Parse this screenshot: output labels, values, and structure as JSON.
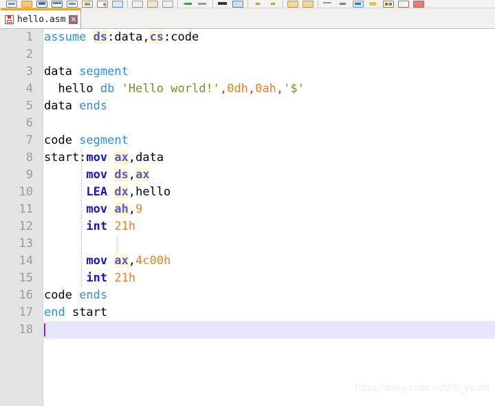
{
  "toolbar": {
    "items": [
      {
        "name": "new-file-icon",
        "glyph": "ic-doc"
      },
      {
        "name": "open-folder-icon",
        "glyph": "ic-folder"
      },
      {
        "name": "save-icon",
        "glyph": "ic-save"
      },
      {
        "name": "save-all-icon",
        "glyph": "ic-saveall"
      },
      {
        "name": "close-file-icon",
        "glyph": "ic-doc"
      },
      {
        "name": "print-icon",
        "glyph": "ic-print"
      },
      {
        "name": "print-preview-icon",
        "glyph": "ic-prev"
      },
      {
        "name": "cut-icon",
        "glyph": "ic-cut"
      },
      {
        "name": "separator",
        "glyph": "sep"
      },
      {
        "name": "copy-icon",
        "glyph": "ic-copy"
      },
      {
        "name": "paste-icon",
        "glyph": "ic-paste"
      },
      {
        "name": "duplicate-icon",
        "glyph": "ic-copy"
      },
      {
        "name": "separator",
        "glyph": "sep"
      },
      {
        "name": "undo-icon",
        "glyph": "ic-undo"
      },
      {
        "name": "redo-icon",
        "glyph": "ic-redo"
      },
      {
        "name": "separator",
        "glyph": "sep"
      },
      {
        "name": "find-icon",
        "glyph": "ic-find"
      },
      {
        "name": "replace-icon",
        "glyph": "ic-replace"
      },
      {
        "name": "separator",
        "glyph": "sep"
      },
      {
        "name": "zoom-in-icon",
        "glyph": "ic-zoomin"
      },
      {
        "name": "zoom-out-icon",
        "glyph": "ic-zoomout"
      },
      {
        "name": "separator",
        "glyph": "sep"
      },
      {
        "name": "tab-marker-icon",
        "glyph": "ic-tab1"
      },
      {
        "name": "whitespace-icon",
        "glyph": "ic-tab2"
      },
      {
        "name": "separator",
        "glyph": "sep"
      },
      {
        "name": "word-wrap-icon",
        "glyph": "ic-wrap"
      },
      {
        "name": "show-all-chars-icon",
        "glyph": "ic-allchar"
      },
      {
        "name": "indent-guide-icon",
        "glyph": "ic-indent"
      },
      {
        "name": "macro-record-icon",
        "glyph": "ic-macro"
      },
      {
        "name": "run-icon",
        "glyph": "ic-run"
      },
      {
        "name": "plugin-manager-icon",
        "glyph": "ic-plugin"
      },
      {
        "name": "close-all-icon",
        "glyph": "ic-close2"
      }
    ]
  },
  "tab": {
    "label": "hello.asm",
    "close_label": "✕",
    "save_icon": "floppy-disk-icon",
    "accent_color": "#f0a32a"
  },
  "editor": {
    "caret_line": 18,
    "current_line_color": "#e6e6fa",
    "caret_color": "#7a1ec8",
    "gutter_color": "#e4e4e4",
    "lines": [
      {
        "n": "1",
        "tokens": [
          {
            "t": "assume ",
            "c": "t-kw"
          },
          {
            "t": "ds",
            "c": "t-reg"
          },
          {
            "t": ":data,",
            "c": "t-txt"
          },
          {
            "t": "cs",
            "c": "t-reg"
          },
          {
            "t": ":code",
            "c": "t-txt"
          }
        ]
      },
      {
        "n": "2",
        "tokens": []
      },
      {
        "n": "3",
        "tokens": [
          {
            "t": "data ",
            "c": "t-txt"
          },
          {
            "t": "segment",
            "c": "t-kw"
          }
        ]
      },
      {
        "n": "4",
        "tokens": [
          {
            "t": "  hello ",
            "c": "t-txt"
          },
          {
            "t": "db",
            "c": "t-kw"
          },
          {
            "t": " ",
            "c": "t-txt"
          },
          {
            "t": "'Hello world!'",
            "c": "t-str"
          },
          {
            "t": ",",
            "c": "t-op"
          },
          {
            "t": "0dh",
            "c": "t-num"
          },
          {
            "t": ",",
            "c": "t-op"
          },
          {
            "t": "0ah",
            "c": "t-num"
          },
          {
            "t": ",",
            "c": "t-op"
          },
          {
            "t": "'$'",
            "c": "t-str"
          }
        ]
      },
      {
        "n": "5",
        "tokens": [
          {
            "t": "data ",
            "c": "t-txt"
          },
          {
            "t": "ends",
            "c": "t-kw"
          }
        ]
      },
      {
        "n": "6",
        "tokens": []
      },
      {
        "n": "7",
        "tokens": [
          {
            "t": "code ",
            "c": "t-txt"
          },
          {
            "t": "segment",
            "c": "t-kw"
          }
        ]
      },
      {
        "n": "8",
        "tokens": [
          {
            "t": "start:",
            "c": "t-txt"
          },
          {
            "t": "mov",
            "c": "t-ins"
          },
          {
            "t": " ",
            "c": "t-txt"
          },
          {
            "t": "ax",
            "c": "t-reg"
          },
          {
            "t": ",data",
            "c": "t-txt"
          }
        ],
        "guides": [
          1
        ]
      },
      {
        "n": "9",
        "tokens": [
          {
            "t": "      ",
            "c": "t-txt"
          },
          {
            "t": "mov",
            "c": "t-ins"
          },
          {
            "t": " ",
            "c": "t-txt"
          },
          {
            "t": "ds",
            "c": "t-reg"
          },
          {
            "t": ",",
            "c": "t-txt"
          },
          {
            "t": "ax",
            "c": "t-reg"
          }
        ],
        "guides": [
          1
        ]
      },
      {
        "n": "10",
        "tokens": [
          {
            "t": "      ",
            "c": "t-txt"
          },
          {
            "t": "LEA",
            "c": "t-ins"
          },
          {
            "t": " ",
            "c": "t-txt"
          },
          {
            "t": "dx",
            "c": "t-reg"
          },
          {
            "t": ",hello",
            "c": "t-txt"
          }
        ],
        "guides": [
          1
        ]
      },
      {
        "n": "11",
        "tokens": [
          {
            "t": "      ",
            "c": "t-txt"
          },
          {
            "t": "mov",
            "c": "t-ins"
          },
          {
            "t": " ",
            "c": "t-txt"
          },
          {
            "t": "ah",
            "c": "t-reg"
          },
          {
            "t": ",",
            "c": "t-txt"
          },
          {
            "t": "9",
            "c": "t-num"
          }
        ],
        "guides": [
          1
        ]
      },
      {
        "n": "12",
        "tokens": [
          {
            "t": "      ",
            "c": "t-txt"
          },
          {
            "t": "int",
            "c": "t-ins"
          },
          {
            "t": " ",
            "c": "t-txt"
          },
          {
            "t": "21h",
            "c": "t-num"
          }
        ],
        "guides": [
          1
        ]
      },
      {
        "n": "13",
        "tokens": [],
        "guides": [
          1,
          2
        ]
      },
      {
        "n": "14",
        "tokens": [
          {
            "t": "      ",
            "c": "t-txt"
          },
          {
            "t": "mov",
            "c": "t-ins"
          },
          {
            "t": " ",
            "c": "t-txt"
          },
          {
            "t": "ax",
            "c": "t-reg"
          },
          {
            "t": ",",
            "c": "t-txt"
          },
          {
            "t": "4c00h",
            "c": "t-num"
          }
        ],
        "guides": [
          1
        ]
      },
      {
        "n": "15",
        "tokens": [
          {
            "t": "      ",
            "c": "t-txt"
          },
          {
            "t": "int",
            "c": "t-ins"
          },
          {
            "t": " ",
            "c": "t-txt"
          },
          {
            "t": "21h",
            "c": "t-num"
          }
        ],
        "guides": [
          1
        ]
      },
      {
        "n": "16",
        "tokens": [
          {
            "t": "code ",
            "c": "t-txt"
          },
          {
            "t": "ends",
            "c": "t-kw"
          }
        ]
      },
      {
        "n": "17",
        "tokens": [
          {
            "t": "end",
            "c": "t-kw"
          },
          {
            "t": " start",
            "c": "t-txt"
          }
        ]
      },
      {
        "n": "18",
        "tokens": [],
        "current": true
      }
    ]
  },
  "watermark": {
    "text": "https://blog.csdn.net/tb_youth"
  }
}
